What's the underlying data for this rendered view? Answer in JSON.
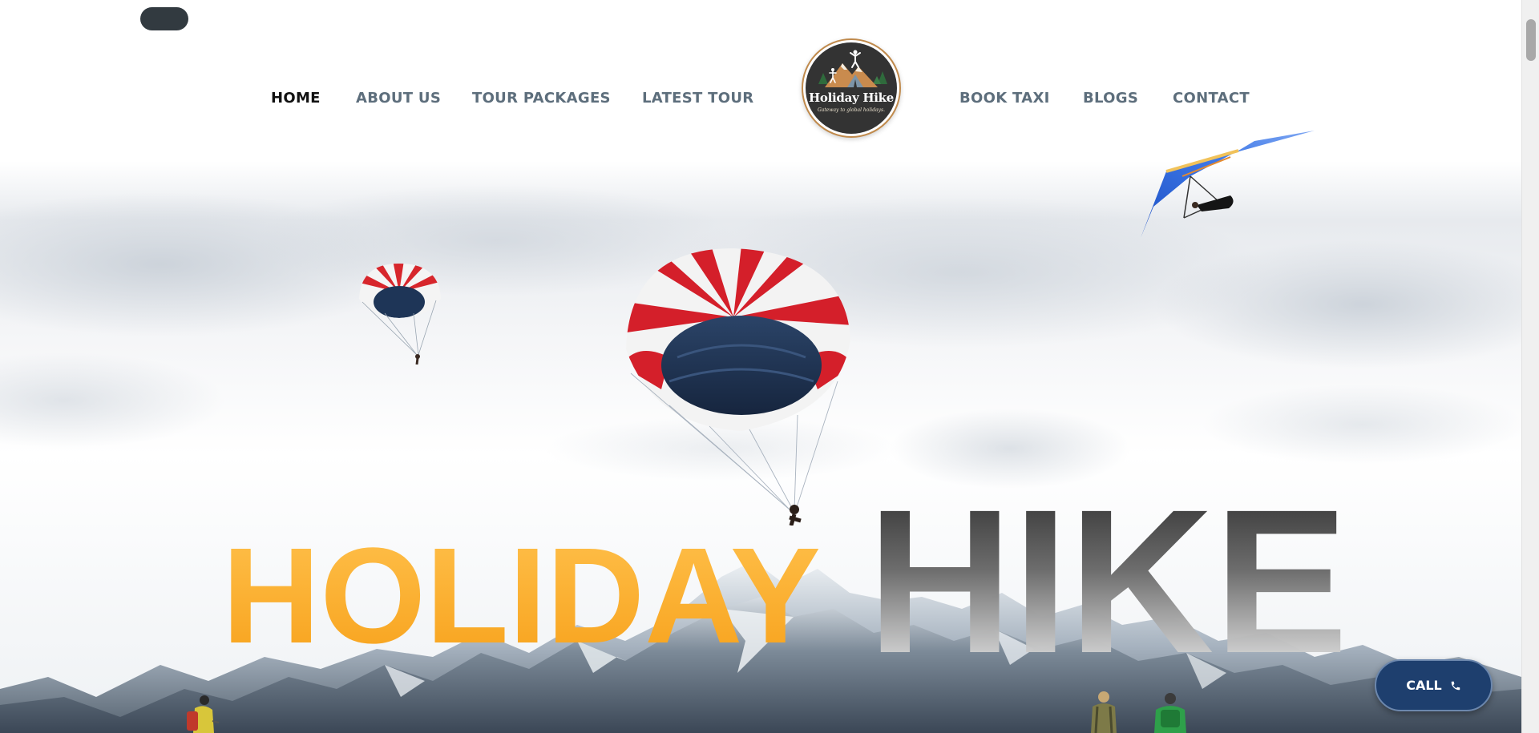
{
  "nav": {
    "items": [
      {
        "label": "HOME",
        "active": true
      },
      {
        "label": "ABOUT US",
        "active": false
      },
      {
        "label": "TOUR PACKAGES",
        "active": false
      },
      {
        "label": "LATEST TOUR",
        "active": false
      },
      {
        "label": "BOOK TAXI",
        "active": false
      },
      {
        "label": "BLOGS",
        "active": false
      },
      {
        "label": "CONTACT",
        "active": false
      }
    ]
  },
  "logo": {
    "title": "Holiday Hike",
    "tagline": "Gateway to global holidays."
  },
  "hero": {
    "word1": "HOLIDAY",
    "word2": "HIKE"
  },
  "call_button": {
    "label": "CALL",
    "icon": "phone-icon"
  },
  "colors": {
    "accent_orange": "#fbb034",
    "call_button_bg": "#1e3f6e",
    "nav_text": "#5d6e7c",
    "nav_active": "#111111"
  }
}
